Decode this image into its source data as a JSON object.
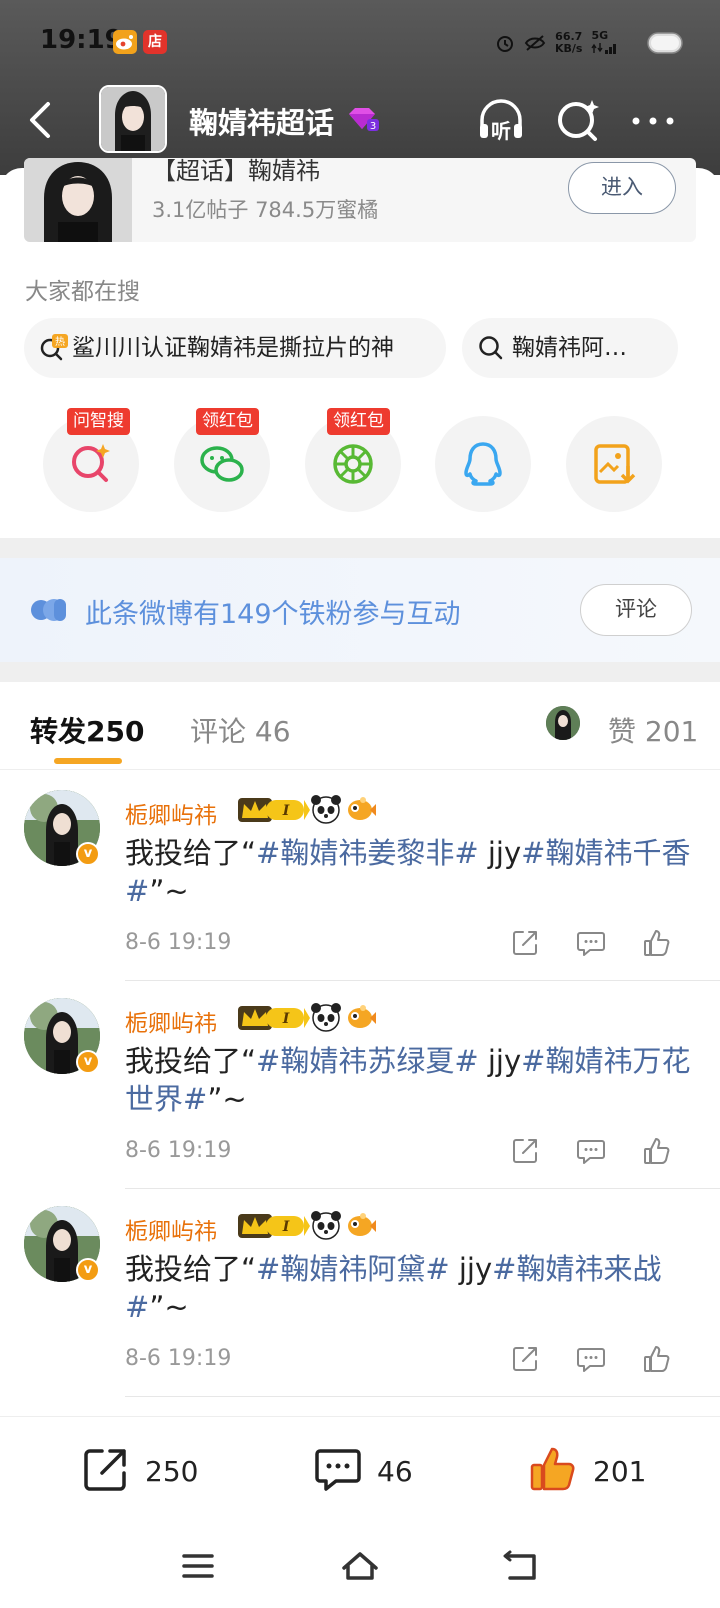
{
  "status_bar": {
    "time": "19:19",
    "badge_shop": "店",
    "net_speed_value": "66.7",
    "net_speed_unit": "KB/s",
    "signal_label": "5G"
  },
  "nav": {
    "title": "鞠婧祎超话",
    "listen_label": "听"
  },
  "supertopic": {
    "name": "【超话】鞠婧祎",
    "stats": "3.1亿帖子 784.5万蜜橘",
    "enter_label": "进入"
  },
  "search": {
    "section_title": "大家都在搜",
    "hot_badge": "热",
    "suggestions": [
      "鲨川川认证鞠婧祎是撕拉片的神",
      "鞠婧祎阿…"
    ]
  },
  "share": {
    "items": [
      {
        "tag": "问智搜"
      },
      {
        "tag": "领红包"
      },
      {
        "tag": "领红包"
      },
      {
        "tag": ""
      },
      {
        "tag": ""
      }
    ]
  },
  "fans": {
    "text": "此条微博有149个铁粉参与互动",
    "button": "评论"
  },
  "tabs": {
    "repost_label": "转发",
    "repost_count": "250",
    "comment_label": "评论",
    "comment_count": "46",
    "like_label": "赞",
    "like_count": "201"
  },
  "comments": [
    {
      "user": "栀卿屿祎",
      "verified": "v",
      "text_plain": "我投给了“",
      "tag1": "#鞠婧祎姜黎非#",
      "mid": " jjy",
      "tag2": "#鞠婧祎千香#",
      "tail": "”~",
      "time": "8-6 19:19"
    },
    {
      "user": "栀卿屿祎",
      "verified": "v",
      "text_plain": "我投给了“",
      "tag1": "#鞠婧祎苏绿夏#",
      "mid": " jjy",
      "tag2": "#鞠婧祎万花世界#",
      "tail": "”~",
      "time": "8-6 19:19"
    },
    {
      "user": "栀卿屿祎",
      "verified": "v",
      "text_plain": "我投给了“",
      "tag1": "#鞠婧祎阿黛#",
      "mid": " jjy",
      "tag2": "#鞠婧祎来战#",
      "tail": "”~",
      "time": "8-6 19:19"
    }
  ],
  "bottom_bar": {
    "repost_count": "250",
    "comment_count": "46",
    "like_count": "201"
  },
  "colors": {
    "accent_orange": "#f5a623",
    "username_orange": "#e8710a",
    "link_blue": "#4b6aa0",
    "fans_blue": "#5d90dc",
    "tag_red": "#ee3b2f"
  }
}
